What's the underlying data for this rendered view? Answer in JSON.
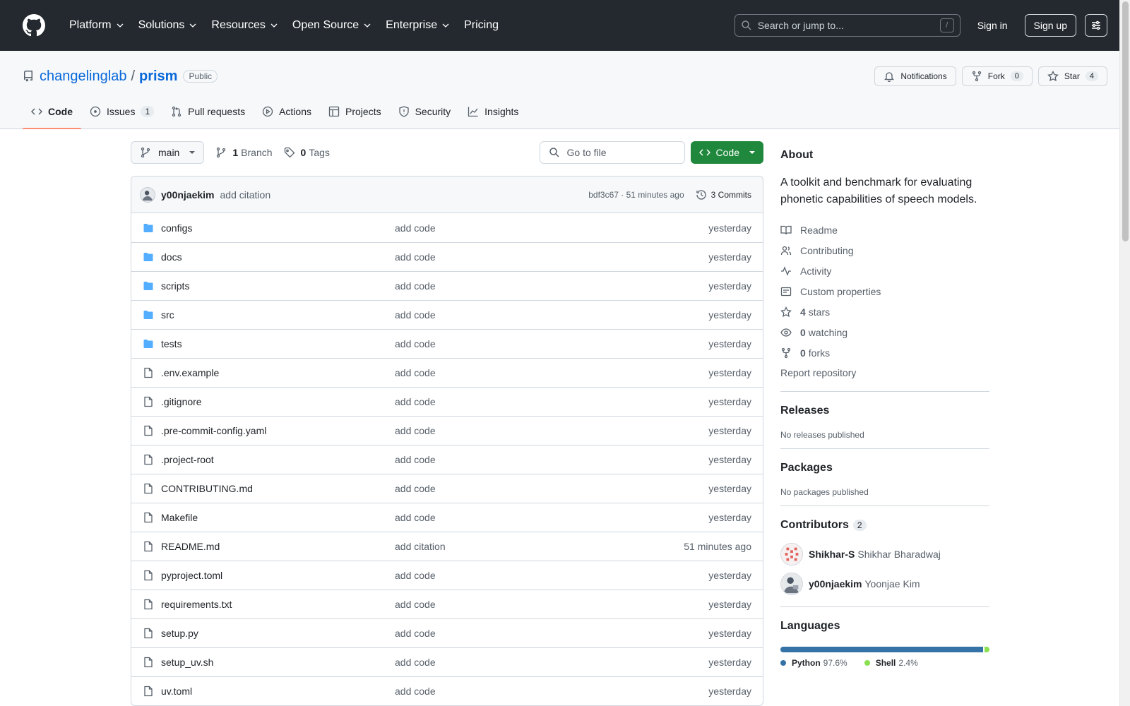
{
  "header": {
    "nav": [
      "Platform",
      "Solutions",
      "Resources",
      "Open Source",
      "Enterprise",
      "Pricing"
    ],
    "search_placeholder": "Search or jump to...",
    "search_shortcut": "/",
    "signin": "Sign in",
    "signup": "Sign up"
  },
  "repo": {
    "owner": "changelinglab",
    "separator": "/",
    "name": "prism",
    "visibility": "Public",
    "notifications_label": "Notifications",
    "fork_label": "Fork",
    "fork_count": "0",
    "star_label": "Star",
    "star_count": "4"
  },
  "tabs": [
    {
      "label": "Code",
      "icon": "code-icon",
      "counter": ""
    },
    {
      "label": "Issues",
      "icon": "issue-icon",
      "counter": "1"
    },
    {
      "label": "Pull requests",
      "icon": "pull-request-icon",
      "counter": ""
    },
    {
      "label": "Actions",
      "icon": "play-icon",
      "counter": ""
    },
    {
      "label": "Projects",
      "icon": "table-icon",
      "counter": ""
    },
    {
      "label": "Security",
      "icon": "shield-icon",
      "counter": ""
    },
    {
      "label": "Insights",
      "icon": "graph-icon",
      "counter": ""
    }
  ],
  "filenav": {
    "branch": "main",
    "branch_count": "1",
    "branch_label": "Branch",
    "tag_count": "0",
    "tag_label": "Tags",
    "goto_placeholder": "Go to file",
    "code_button": "Code"
  },
  "commit": {
    "author": "y00njaekim",
    "message": "add citation",
    "meta": "bdf3c67 · 51 minutes ago",
    "commits_label": "3 Commits"
  },
  "files": [
    {
      "name": "configs",
      "type": "dir",
      "message": "add code",
      "date": "yesterday"
    },
    {
      "name": "docs",
      "type": "dir",
      "message": "add code",
      "date": "yesterday"
    },
    {
      "name": "scripts",
      "type": "dir",
      "message": "add code",
      "date": "yesterday"
    },
    {
      "name": "src",
      "type": "dir",
      "message": "add code",
      "date": "yesterday"
    },
    {
      "name": "tests",
      "type": "dir",
      "message": "add code",
      "date": "yesterday"
    },
    {
      "name": ".env.example",
      "type": "file",
      "message": "add code",
      "date": "yesterday"
    },
    {
      "name": ".gitignore",
      "type": "file",
      "message": "add code",
      "date": "yesterday"
    },
    {
      "name": ".pre-commit-config.yaml",
      "type": "file",
      "message": "add code",
      "date": "yesterday"
    },
    {
      "name": ".project-root",
      "type": "file",
      "message": "add code",
      "date": "yesterday"
    },
    {
      "name": "CONTRIBUTING.md",
      "type": "file",
      "message": "add code",
      "date": "yesterday"
    },
    {
      "name": "Makefile",
      "type": "file",
      "message": "add code",
      "date": "yesterday"
    },
    {
      "name": "README.md",
      "type": "file",
      "message": "add citation",
      "date": "51 minutes ago"
    },
    {
      "name": "pyproject.toml",
      "type": "file",
      "message": "add code",
      "date": "yesterday"
    },
    {
      "name": "requirements.txt",
      "type": "file",
      "message": "add code",
      "date": "yesterday"
    },
    {
      "name": "setup.py",
      "type": "file",
      "message": "add code",
      "date": "yesterday"
    },
    {
      "name": "setup_uv.sh",
      "type": "file",
      "message": "add code",
      "date": "yesterday"
    },
    {
      "name": "uv.toml",
      "type": "file",
      "message": "add code",
      "date": "yesterday"
    }
  ],
  "about": {
    "title": "About",
    "description": "A toolkit and benchmark for evaluating phonetic capabilities of speech models.",
    "links": {
      "readme": "Readme",
      "contributing": "Contributing",
      "activity": "Activity",
      "custom_properties": "Custom properties",
      "stars_count": "4",
      "stars_label": "stars",
      "watching_count": "0",
      "watching_label": "watching",
      "forks_count": "0",
      "forks_label": "forks"
    },
    "report": "Report repository"
  },
  "releases": {
    "title": "Releases",
    "empty": "No releases published"
  },
  "packages": {
    "title": "Packages",
    "empty": "No packages published"
  },
  "contributors": {
    "title": "Contributors",
    "count": "2",
    "list": [
      {
        "login": "Shikhar-S",
        "name": "Shikhar Bharadwaj"
      },
      {
        "login": "y00njaekim",
        "name": "Yoonjae Kim"
      }
    ]
  },
  "languages": {
    "title": "Languages",
    "list": [
      {
        "name": "Python",
        "percent": "97.6%",
        "value": 97.6,
        "color": "#3572A5"
      },
      {
        "name": "Shell",
        "percent": "2.4%",
        "value": 2.4,
        "color": "#89e051"
      }
    ]
  },
  "colors": {
    "header_bg": "#24292f",
    "link": "#0969da",
    "code_button": "#1f883d",
    "folder": "#54aeff",
    "active_tab_underline": "#fd8c73"
  }
}
